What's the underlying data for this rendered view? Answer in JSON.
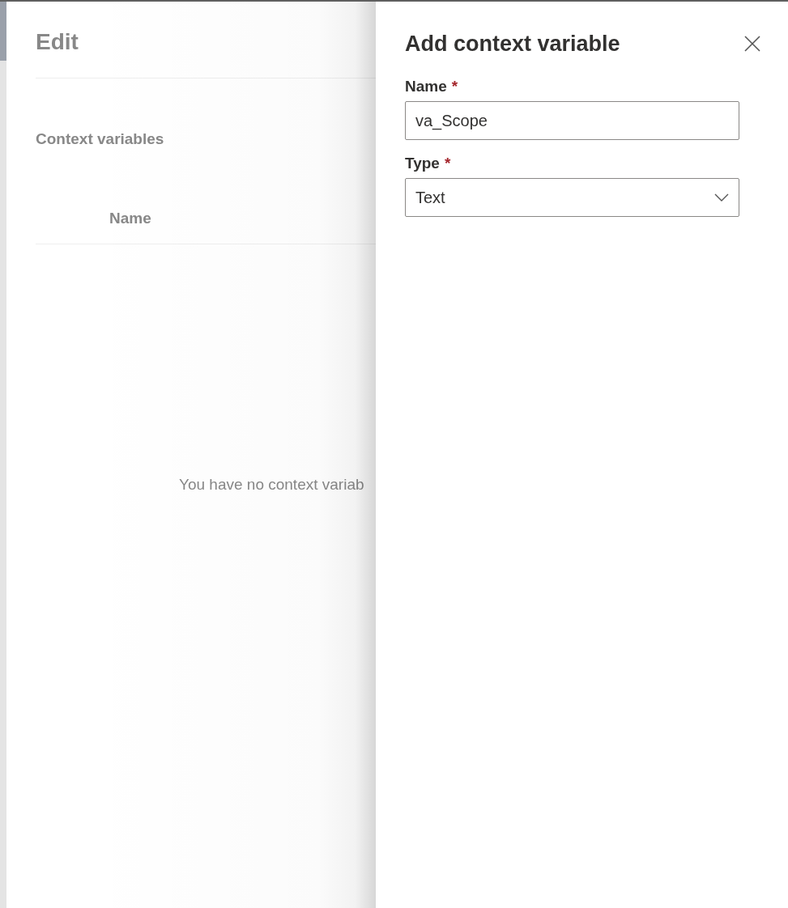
{
  "background_dialog": {
    "title": "Edit",
    "section_title": "Context variables",
    "table": {
      "columns": [
        "Name"
      ]
    },
    "empty_message": "You have no context variab"
  },
  "panel": {
    "title": "Add context variable",
    "fields": [
      {
        "kind": "text",
        "label": "Name",
        "required_mark": "*",
        "value": "va_Scope"
      },
      {
        "kind": "dropdown",
        "label": "Type",
        "required_mark": "*",
        "value": "Text"
      }
    ]
  }
}
